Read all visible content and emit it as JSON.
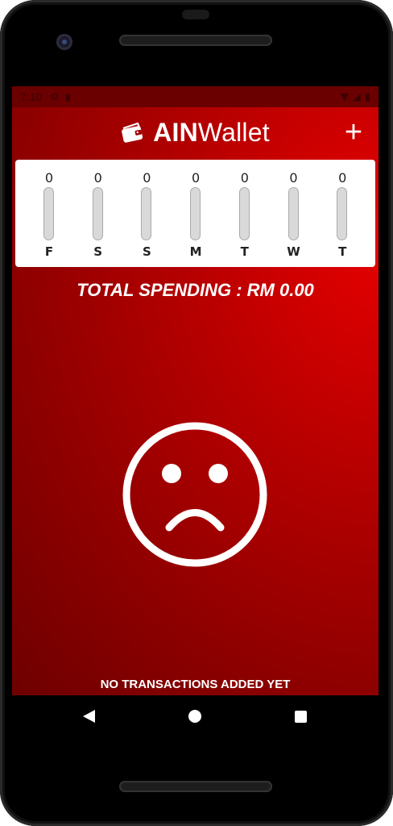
{
  "status_bar": {
    "time": "7:10"
  },
  "app": {
    "title_bold": "AIN",
    "title_light": "Wallet",
    "add_label": "+"
  },
  "chart_data": {
    "type": "bar",
    "categories": [
      "F",
      "S",
      "S",
      "M",
      "T",
      "W",
      "T"
    ],
    "values": [
      0,
      0,
      0,
      0,
      0,
      0,
      0
    ],
    "value_labels": [
      "0",
      "0",
      "0",
      "0",
      "0",
      "0",
      "0"
    ],
    "ylim": [
      0,
      1
    ],
    "bar_color": "#b30000",
    "track_color": "#d9d9d9"
  },
  "summary": {
    "total_spending": "TOTAL SPENDING : RM 0.00"
  },
  "empty_state": {
    "icon": "sad-face-icon",
    "message": "NO TRANSACTIONS ADDED YET"
  },
  "colors": {
    "primary": "#cc0000",
    "primary_dark": "#6b0000",
    "on_primary": "#ffffff"
  }
}
